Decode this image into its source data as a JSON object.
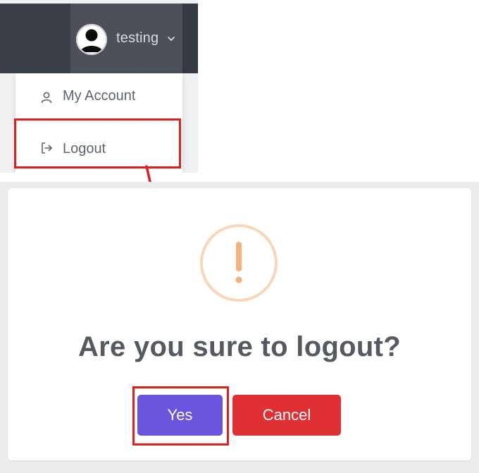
{
  "header": {
    "username": "testing",
    "avatar_icon": "user-silhouette-icon",
    "toggle_icon": "chevron-down-icon",
    "background_color": "#3c414a"
  },
  "dropdown": {
    "items": [
      {
        "label": "My Account",
        "icon": "person-icon"
      },
      {
        "label": "Logout",
        "icon": "logout-icon"
      }
    ]
  },
  "modal": {
    "icon": "warning-exclamation-icon",
    "icon_color": "#f8bb86",
    "title": "Are you sure to logout?",
    "confirm_label": "Yes",
    "cancel_label": "Cancel",
    "confirm_color": "#6a56dc",
    "cancel_color": "#df3034"
  },
  "annotations": {
    "highlight_color": "#e01e1e",
    "arrow_color": "#e01e1e"
  }
}
